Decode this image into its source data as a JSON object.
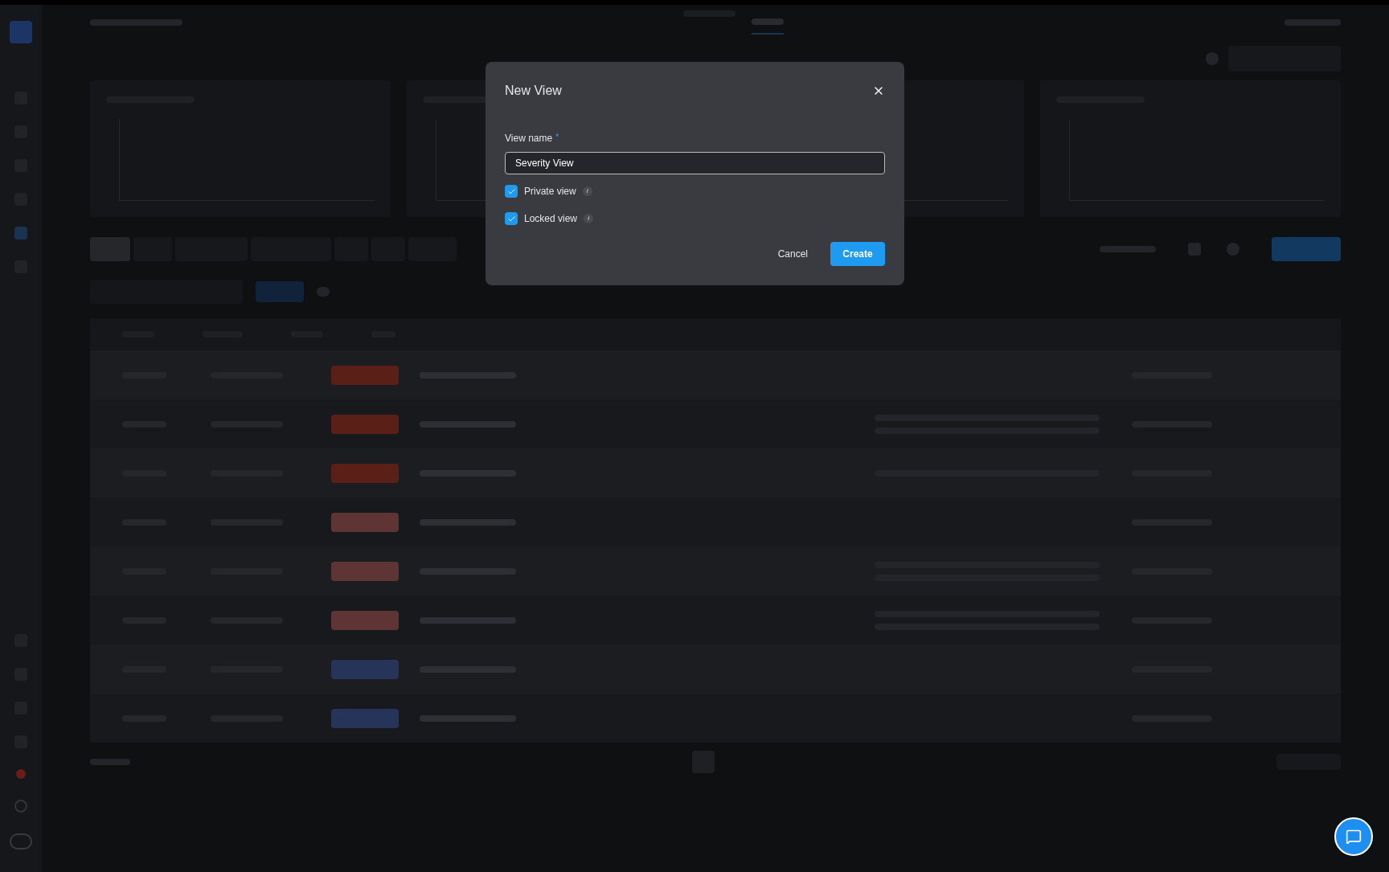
{
  "section_tabs": [
    {
      "selected": true
    },
    {
      "selected": false
    },
    {
      "selected": false
    },
    {
      "selected": false
    },
    {
      "selected": false
    },
    {
      "selected": false
    },
    {
      "selected": false
    }
  ],
  "dialog": {
    "title": "New View",
    "field_label": "View name",
    "required_mark": "*",
    "field_value": "Severity View",
    "options": [
      {
        "label": "Private view",
        "checked": true,
        "info": "i"
      },
      {
        "label": "Locked view",
        "checked": true,
        "info": "i"
      }
    ],
    "cancel": "Cancel",
    "create": "Create"
  }
}
